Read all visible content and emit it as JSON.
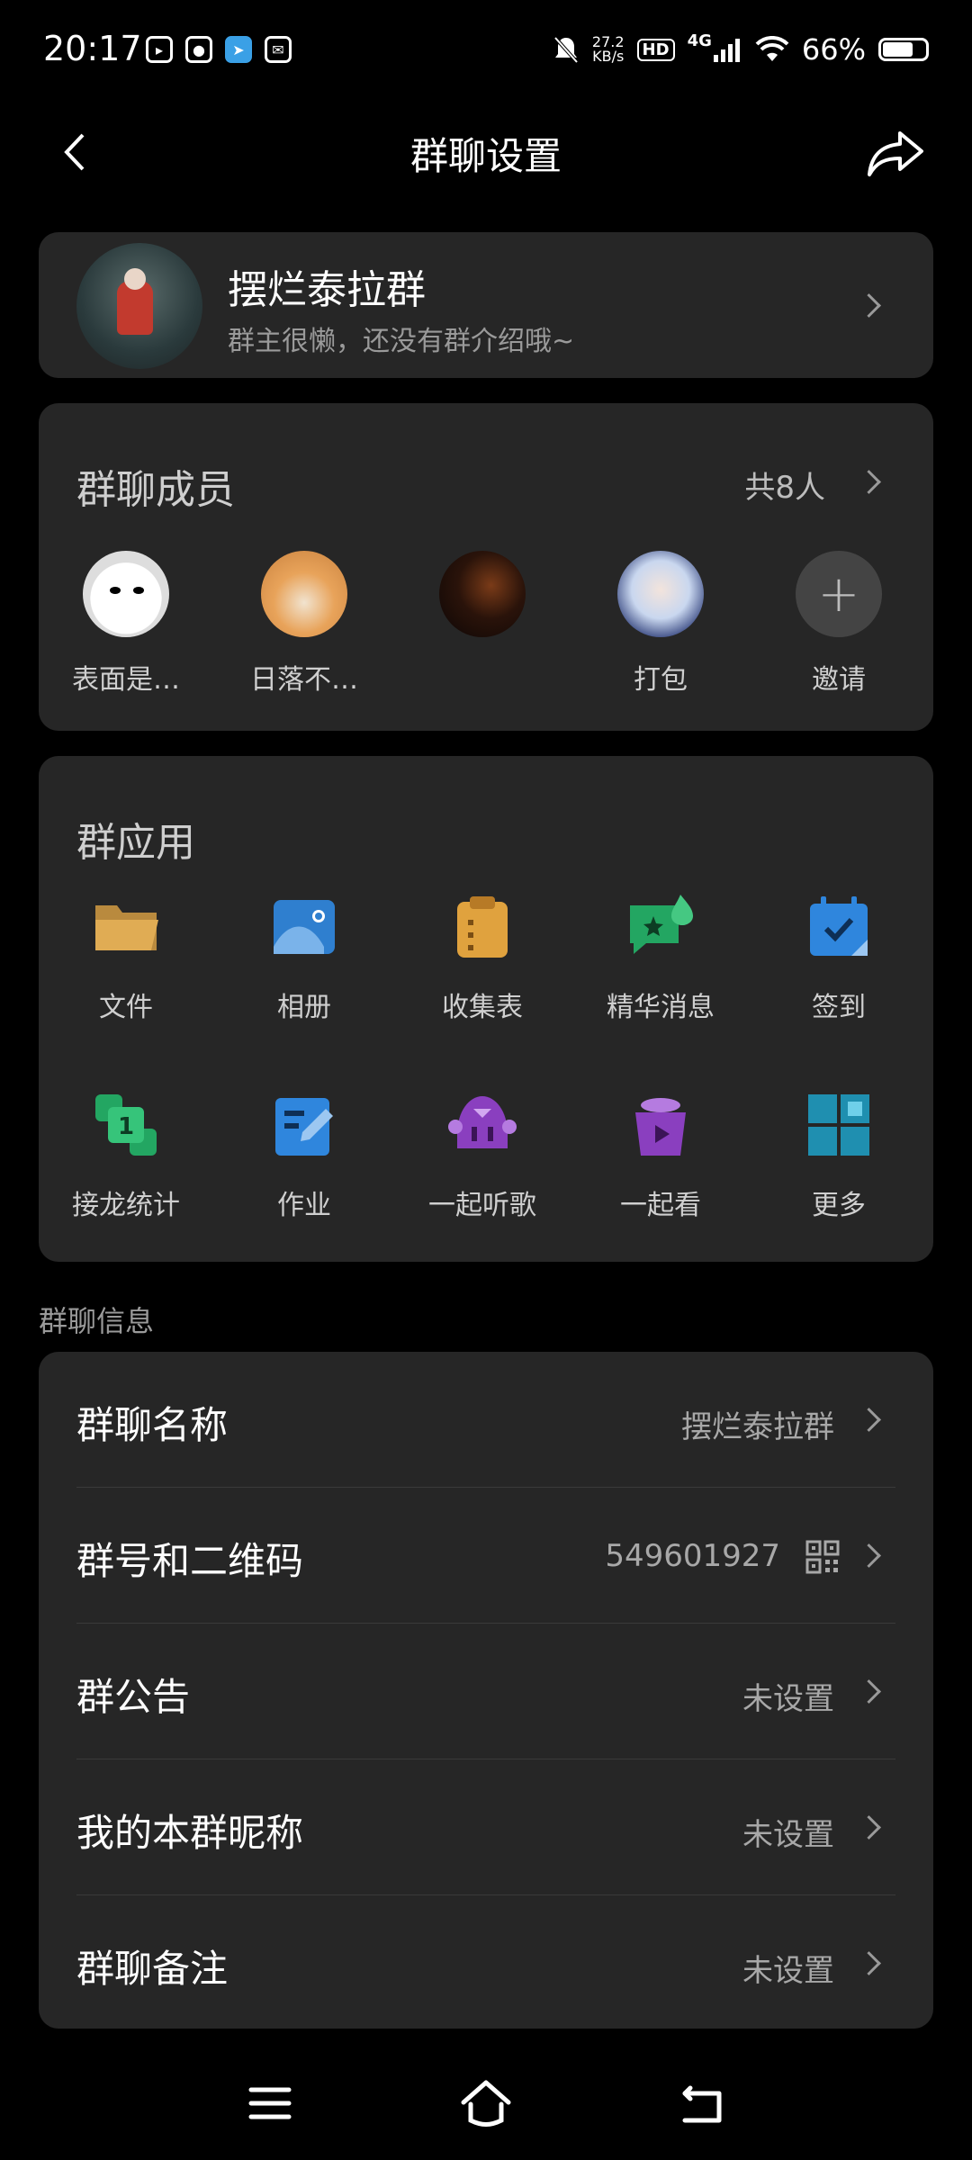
{
  "status_bar": {
    "time": "20:17",
    "net_speed_value": "27.2",
    "net_speed_unit": "KB/s",
    "hd": "HD",
    "network": "4G",
    "battery": "66%",
    "battery_level": 0.66
  },
  "header": {
    "title": "群聊设置"
  },
  "group": {
    "name": "摆烂泰拉群",
    "description": "群主很懒，还没有群介绍哦~"
  },
  "members": {
    "title": "群聊成员",
    "count_text": "共8人",
    "list": [
      {
        "name": "表面是…"
      },
      {
        "name": "日落不…"
      },
      {
        "name": ""
      },
      {
        "name": "打包"
      },
      {
        "name": "邀请"
      }
    ]
  },
  "apps": {
    "title": "群应用",
    "items": [
      {
        "label": "文件",
        "icon": "folder-icon"
      },
      {
        "label": "相册",
        "icon": "album-icon"
      },
      {
        "label": "收集表",
        "icon": "clipboard-icon"
      },
      {
        "label": "精华消息",
        "icon": "highlight-message-icon"
      },
      {
        "label": "签到",
        "icon": "calendar-checkin-icon"
      },
      {
        "label": "接龙统计",
        "icon": "relay-stats-icon"
      },
      {
        "label": "作业",
        "icon": "homework-icon"
      },
      {
        "label": "一起听歌",
        "icon": "listen-together-icon"
      },
      {
        "label": "一起看",
        "icon": "watch-together-icon"
      },
      {
        "label": "更多",
        "icon": "more-grid-icon"
      }
    ]
  },
  "info": {
    "section_label": "群聊信息",
    "rows": [
      {
        "label": "群聊名称",
        "value": "摆烂泰拉群"
      },
      {
        "label": "群号和二维码",
        "value": "549601927"
      },
      {
        "label": "群公告",
        "value": "未设置"
      },
      {
        "label": "我的本群昵称",
        "value": "未设置"
      },
      {
        "label": "群聊备注",
        "value": "未设置"
      }
    ]
  },
  "colors": {
    "background": "#000000",
    "card": "#262626",
    "text_secondary": "#9a9a9a"
  }
}
